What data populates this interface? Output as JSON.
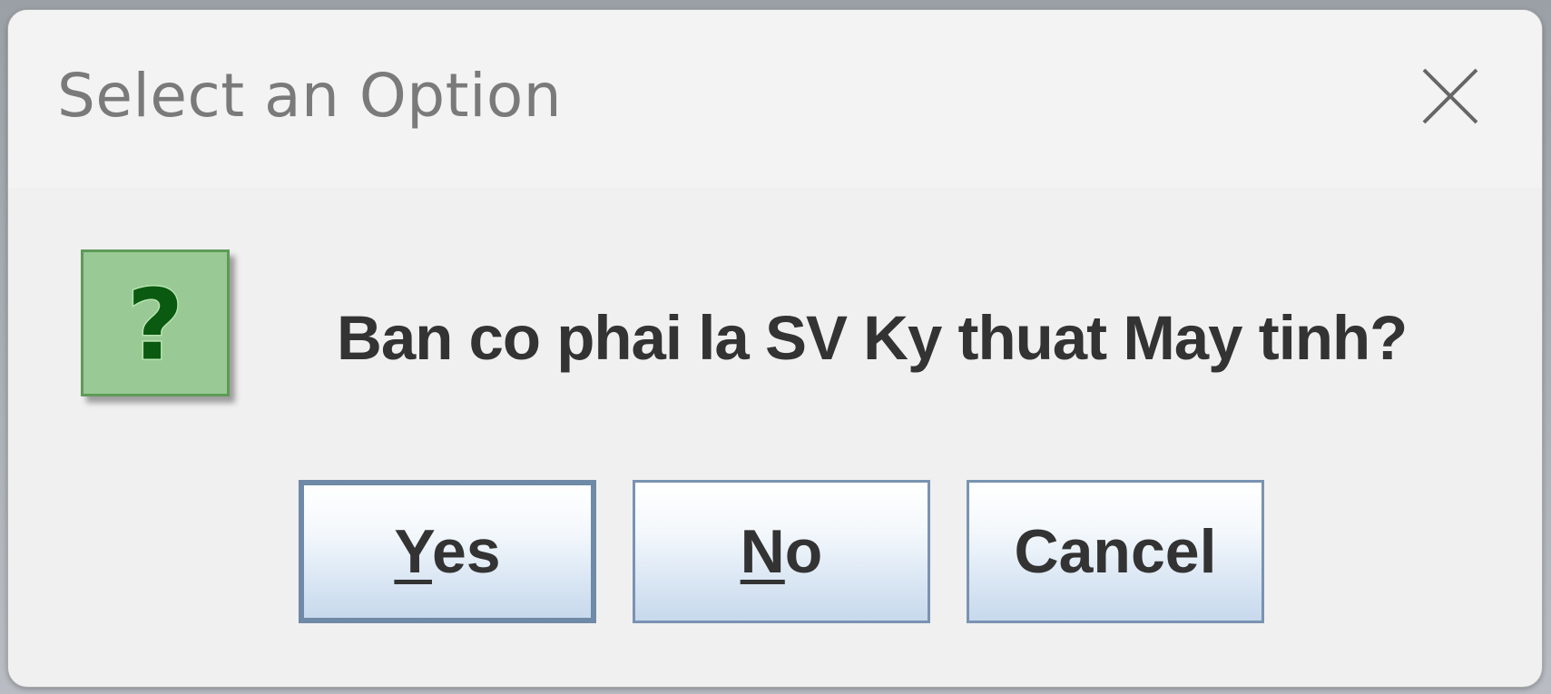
{
  "dialog": {
    "title": "Select an Option",
    "message": "Ban co phai la SV Ky thuat May tinh?",
    "icon": "question-icon",
    "buttons": {
      "yes": {
        "mnemonic": "Y",
        "rest": "es"
      },
      "no": {
        "mnemonic": "N",
        "rest": "o"
      },
      "cancel": {
        "label": "Cancel"
      }
    }
  },
  "colors": {
    "icon_bg": "#99c994",
    "icon_glyph": "#0b5a12",
    "button_border": "#7a93b2"
  }
}
